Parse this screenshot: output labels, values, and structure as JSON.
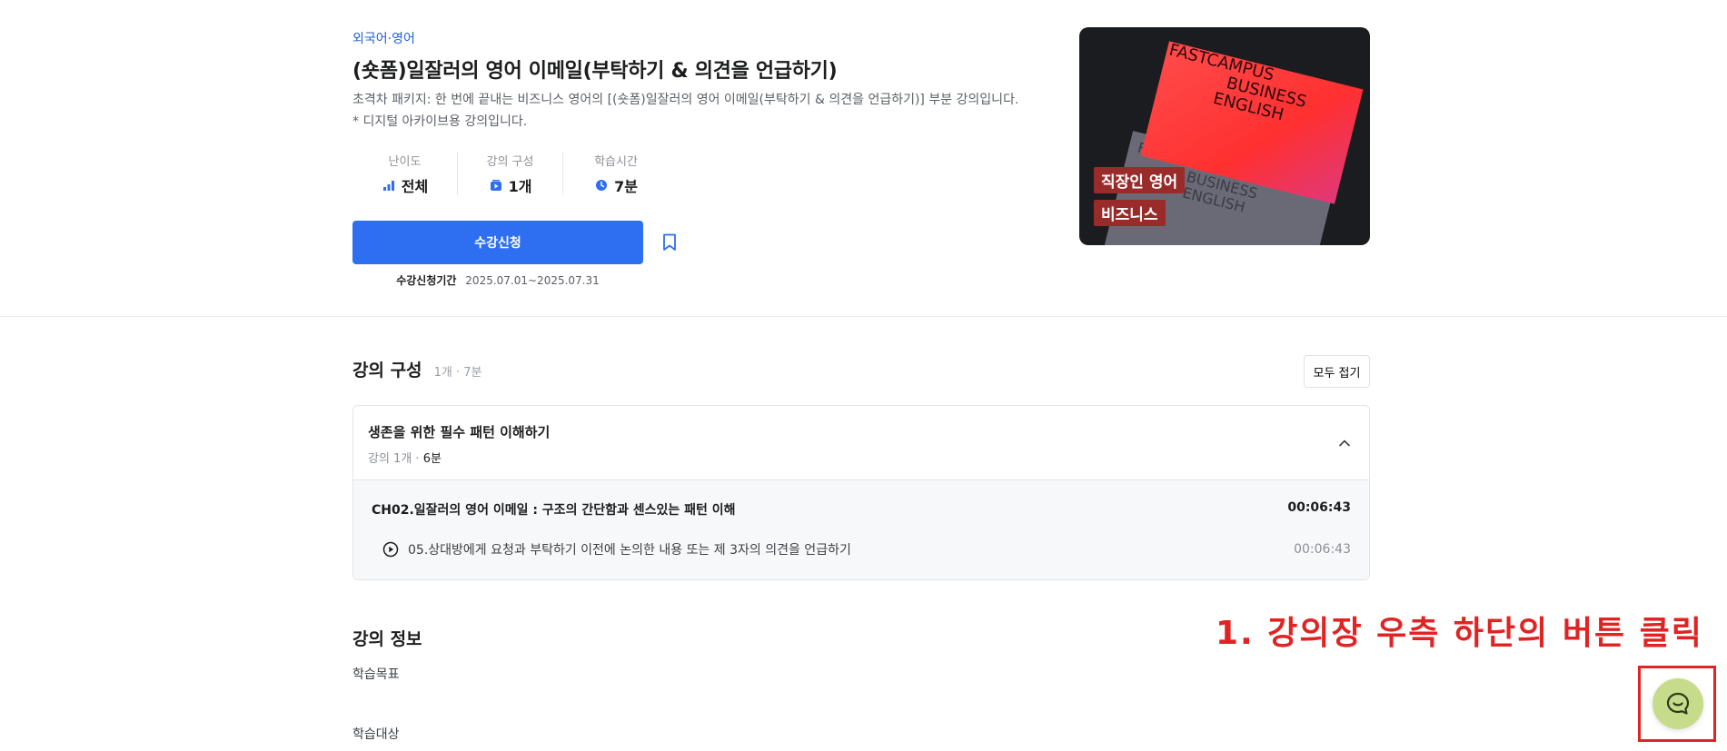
{
  "course": {
    "category": "외국어·영어",
    "title": "(숏폼)일잘러의 영어 이메일(부탁하기 & 의견을 언급하기)",
    "description": "초격차 패키지: 한 번에 끝내는 비즈니스 영어의 [(숏폼)일잘러의 영어 이메일(부탁하기 & 의견을 언급하기)] 부분 강의입니다. * 디지털 아카이브용 강의입니다.",
    "stats": [
      {
        "label": "난이도",
        "value": "전체",
        "icon": "level-icon"
      },
      {
        "label": "강의 구성",
        "value": "1개",
        "icon": "video-icon"
      },
      {
        "label": "학습시간",
        "value": "7분",
        "icon": "clock-icon"
      }
    ],
    "enroll_label": "수강신청",
    "enroll_period_label": "수강신청기간",
    "enroll_period_value": "2025.07.01~2025.07.31",
    "thumbnail": {
      "card_text": [
        "FASTCAMPUS",
        "BUSINESS",
        "ENGLISH"
      ],
      "back_text": [
        "FASTCAMPUS",
        "BUSINESS",
        "ENGLISH"
      ],
      "tags": [
        "직장인 영어",
        "비즈니스"
      ]
    }
  },
  "curriculum": {
    "title": "강의 구성",
    "meta": "1개 · 7분",
    "collapse_label": "모두 접기",
    "chapter": {
      "title": "생존을 위한 필수 패턴 이해하기",
      "meta_prefix": "강의 1개 · ",
      "meta_time": "6분",
      "subchapter_title": "CH02.일잘러의 영어 이메일 : 구조의 간단함과 센스있는 패턴 이해",
      "subchapter_time": "00:06:43",
      "lesson_title": "05.상대방에게 요청과 부탁하기 이전에 논의한 내용 또는 제 3자의 의견을 언급하기",
      "lesson_time": "00:06:43"
    }
  },
  "info": {
    "title": "강의 정보",
    "goal_label": "학습목표",
    "target_label": "학습대상"
  },
  "annotation": {
    "text": "1. 강의장 우측 하단의 버튼 클릭"
  },
  "colors": {
    "accent": "#2e6ff2",
    "annotation": "#e02424",
    "chat_button": "#c7dc8a"
  }
}
